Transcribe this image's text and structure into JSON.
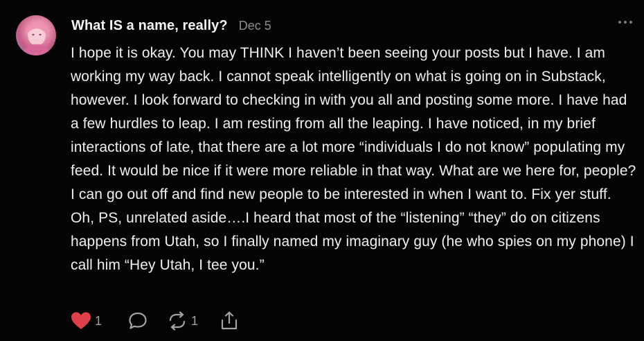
{
  "post": {
    "author": "What IS a name, really?",
    "date": "Dec 5",
    "text": "I hope it is okay. You may THINK I haven’t been seeing your posts but I have. I am working my way back. I cannot speak intelligently on what is going on in Substack, however. I look forward to checking in with you all and posting some more. I have had a few hurdles to leap. I am resting from all the leaping. I have noticed, in my brief interactions of late, that there are a lot more “individuals I do not know” populating my feed. It would be nice if it were more reliable in that way. What are we here for, people? I can go out off and find new people to be interested in when I want to. Fix yer stuff. Oh, PS, unrelated aside….I heard that most of the “listening” “they” do on citizens happens from Utah, so I finally named my imaginary guy (he who spies on my phone) I call him “Hey Utah, I tee you.”"
  },
  "actions": {
    "like_count": "1",
    "restack_count": "1"
  },
  "icons": {
    "like": "heart-icon",
    "comment": "comment-bubble-icon",
    "restack": "restack-icon",
    "share": "share-icon",
    "more": "more-dots-icon"
  },
  "colors": {
    "background": "#050505",
    "like_red": "#e0404a",
    "muted": "#8d8d8d"
  }
}
